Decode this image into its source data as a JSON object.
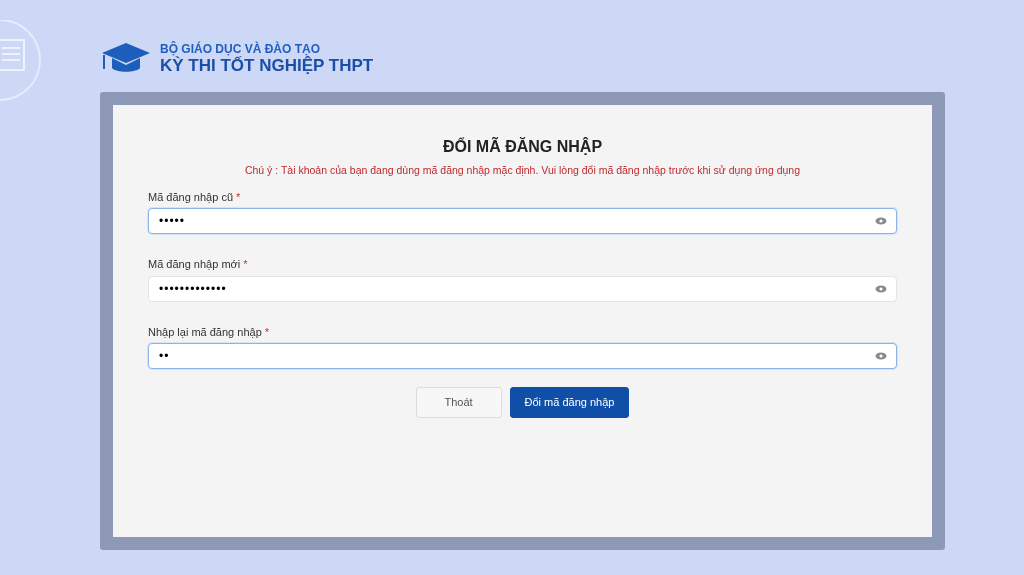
{
  "header": {
    "ministry": "BỘ GIÁO DỤC VÀ ĐÀO TẠO",
    "exam": "KỲ THI TỐT NGHIỆP THPT"
  },
  "form": {
    "title": "ĐỔI MÃ ĐĂNG NHẬP",
    "notice": "Chú ý : Tài khoản của bạn đang dùng mã đăng nhập mặc định. Vui lòng đổi mã đăng nhập trước khi sử dụng ứng dụng",
    "fields": [
      {
        "label": "Mã đăng nhập cũ",
        "required_mark": "*",
        "value": "•••••",
        "focused": true
      },
      {
        "label": "Mã đăng nhập mới",
        "required_mark": "*",
        "value": "•••••••••••••",
        "focused": false
      },
      {
        "label": "Nhập lại mã đăng nhập",
        "required_mark": "*",
        "value": "••",
        "focused": true
      }
    ],
    "buttons": [
      {
        "label": "Thoát",
        "kind": "secondary"
      },
      {
        "label": "Đổi mã đăng nhập",
        "kind": "primary"
      }
    ]
  }
}
